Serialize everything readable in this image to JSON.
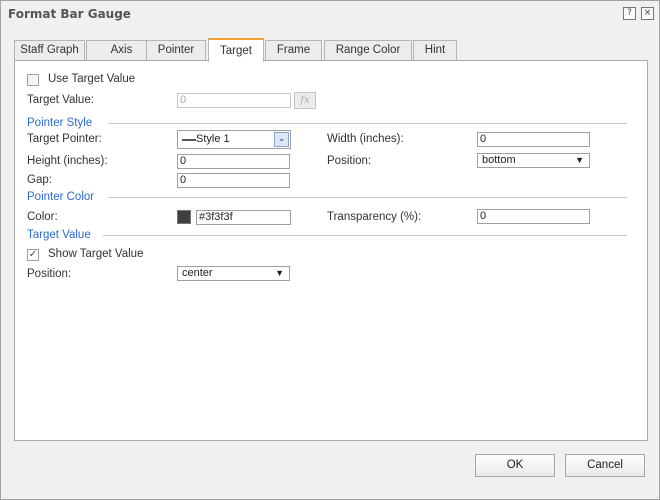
{
  "dialog": {
    "title": "Format Bar Gauge",
    "help_icon_glyph": "?",
    "close_icon_glyph": "×"
  },
  "tabs": [
    {
      "label": "Staff Graph",
      "active": false
    },
    {
      "label": "Axis",
      "active": false
    },
    {
      "label": "Pointer",
      "active": false
    },
    {
      "label": "Target",
      "active": true
    },
    {
      "label": "Frame",
      "active": false
    },
    {
      "label": "Range Color",
      "active": false
    },
    {
      "label": "Hint",
      "active": false
    }
  ],
  "target": {
    "use_target_label": "Use Target Value",
    "use_target_checked": false,
    "target_value_label": "Target Value:",
    "target_value": "0",
    "fx_label": "fx"
  },
  "pointer_style": {
    "section_label": "Pointer Style",
    "target_pointer_label": "Target Pointer:",
    "target_pointer_value": "Style 1",
    "width_label": "Width (inches):",
    "width_value": "0",
    "height_label": "Height (inches):",
    "height_value": "0",
    "position_label": "Position:",
    "position_value": "bottom",
    "gap_label": "Gap:",
    "gap_value": "0"
  },
  "pointer_color": {
    "section_label": "Pointer Color",
    "color_label": "Color:",
    "color_value": "#3f3f3f",
    "swatch_color": "#3f3f3f",
    "transparency_label": "Transparency (%):",
    "transparency_value": "0"
  },
  "target_value_section": {
    "section_label": "Target Value",
    "show_label": "Show Target Value",
    "show_checked": true,
    "position_label": "Position:",
    "position_value": "center"
  },
  "footer": {
    "ok_label": "OK",
    "cancel_label": "Cancel"
  },
  "colors": {
    "accent_tab": "#f0a030",
    "section_blue": "#2d6cbf"
  }
}
